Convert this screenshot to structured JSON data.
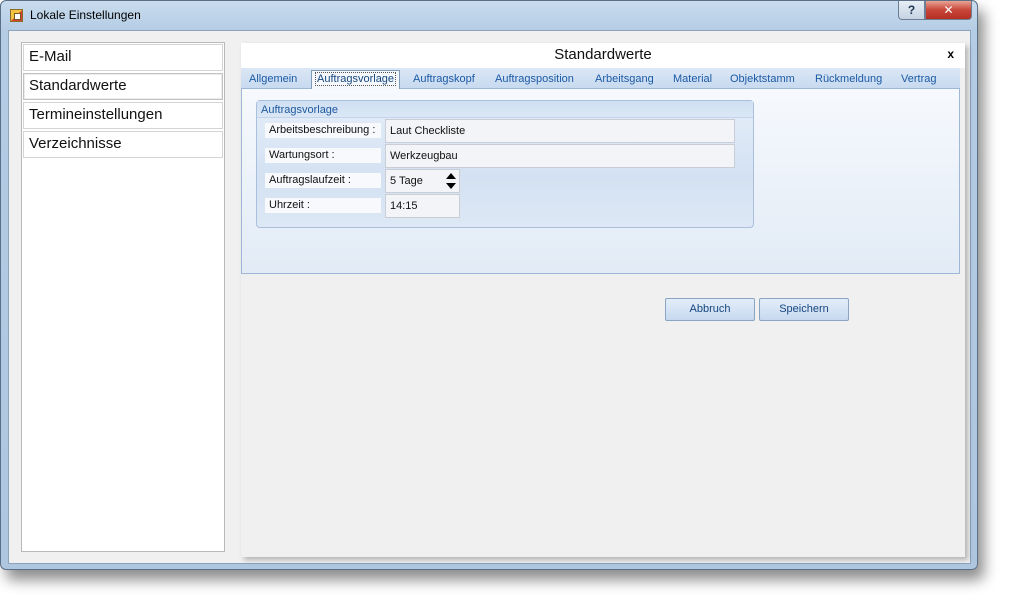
{
  "window": {
    "title": "Lokale Einstellungen",
    "help_label": "?",
    "close_label": "✕"
  },
  "nav": {
    "items": [
      "E-Mail",
      "Standardwerte",
      "Termineinstellungen",
      "Verzeichnisse"
    ]
  },
  "panel": {
    "title": "Standardwerte",
    "close_label": "x",
    "tabs": [
      "Allgemein",
      "Auftragsvorlage",
      "Auftragskopf",
      "Auftragsposition",
      "Arbeitsgang",
      "Material",
      "Objektstamm",
      "Rückmeldung",
      "Vertrag"
    ],
    "active_tab": "Auftragsvorlage"
  },
  "group": {
    "title": "Auftragsvorlage",
    "fields": {
      "arbeitsbeschreibung": {
        "label": "Arbeitsbeschreibung :",
        "value": "Laut Checkliste"
      },
      "wartungsort": {
        "label": "Wartungsort :",
        "value": "Werkzeugbau"
      },
      "auftragslaufzeit": {
        "label": "Auftragslaufzeit :",
        "value": "5 Tage"
      },
      "uhrzeit": {
        "label": "Uhrzeit :",
        "value": "14:15"
      }
    }
  },
  "buttons": {
    "cancel": "Abbruch",
    "save": "Speichern"
  }
}
